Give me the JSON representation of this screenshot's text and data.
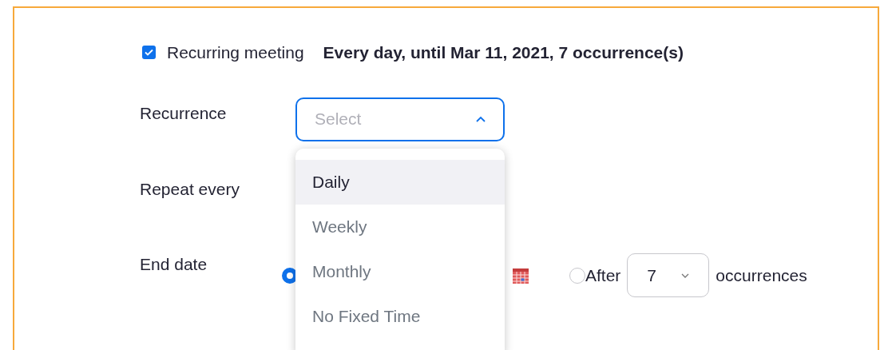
{
  "recurring": {
    "checked": true,
    "label": "Recurring meeting",
    "summary": "Every day, until Mar 11, 2021, 7 occurrence(s)"
  },
  "recurrence": {
    "label": "Recurrence",
    "placeholder": "Select",
    "expanded": true,
    "options": [
      {
        "label": "Daily",
        "selected": true
      },
      {
        "label": "Weekly",
        "selected": false
      },
      {
        "label": "Monthly",
        "selected": false
      },
      {
        "label": "No Fixed Time",
        "selected": false
      }
    ]
  },
  "repeat_every": {
    "label": "Repeat every"
  },
  "end_date": {
    "label": "End date",
    "by_date": {
      "selected": true
    },
    "after": {
      "label": "After",
      "selected": false,
      "count": "7",
      "suffix": "occurrences"
    }
  }
}
